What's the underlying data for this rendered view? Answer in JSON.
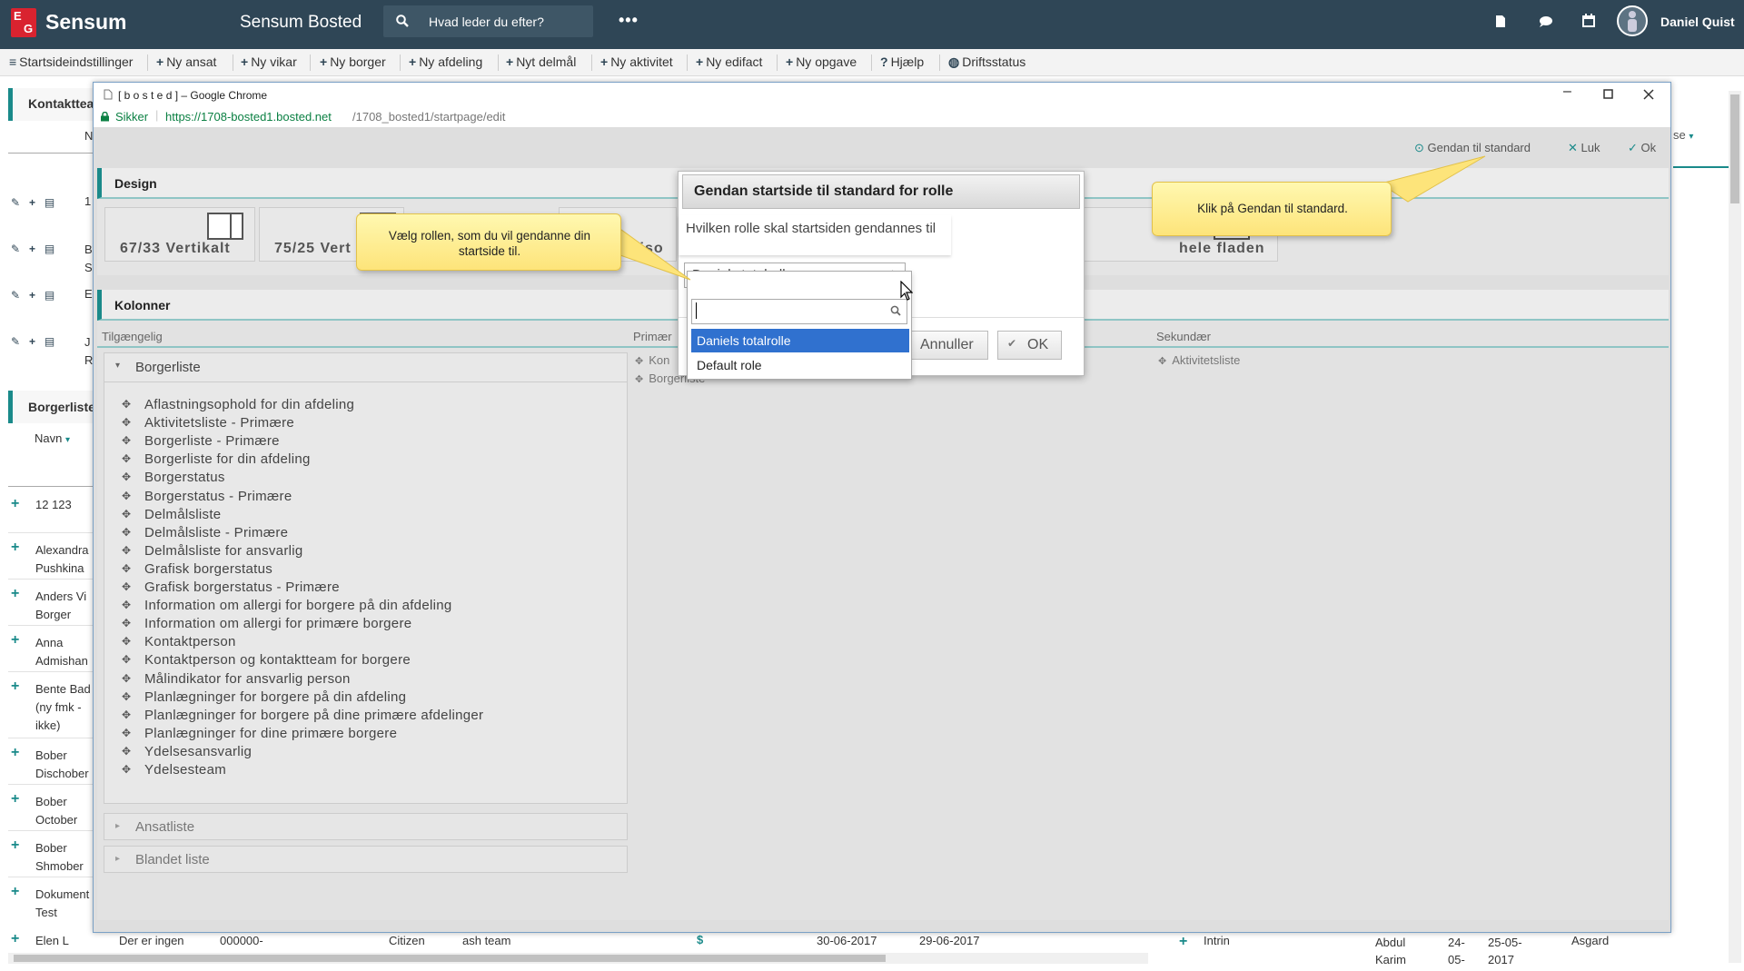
{
  "app": {
    "logo_letters": [
      "E",
      "G"
    ],
    "logo_text": "Sensum",
    "title": "Sensum Bosted",
    "search_placeholder": "Hvad leder du efter?",
    "more": "•••",
    "user": "Daniel Quist"
  },
  "toolbar": [
    {
      "label": "Startsideindstillinger",
      "icon": "≡"
    },
    {
      "label": "Ny ansat",
      "icon": "+"
    },
    {
      "label": "Ny vikar",
      "icon": "+"
    },
    {
      "label": "Ny borger",
      "icon": "+"
    },
    {
      "label": "Ny afdeling",
      "icon": "+"
    },
    {
      "label": "Nyt delmål",
      "icon": "+"
    },
    {
      "label": "Ny aktivitet",
      "icon": "+"
    },
    {
      "label": "Ny edifact",
      "icon": "+"
    },
    {
      "label": "Ny opgave",
      "icon": "+"
    },
    {
      "label": "Hjælp",
      "icon": "?"
    },
    {
      "label": "Driftsstatus",
      "icon": "◍"
    }
  ],
  "background": {
    "kontakt_title": "Kontakttea",
    "kontakt_n": "N",
    "kontakt_rows": [
      "1",
      "B\nS",
      "E",
      "J\nR"
    ],
    "borger_title": "Borgerliste",
    "borger_col": "Navn",
    "borger_first": "12 123",
    "borger_rows": [
      "Alexandra\nPushkina",
      "Anders Vi\nBorger",
      "Anna\nAdmishan",
      "Bente Bad\n(ny fmk -\nikke)",
      "Bober\nDischober",
      "Bober\nOctober",
      "Bober\nShmober",
      "Dokument\nTest",
      "Elen L"
    ],
    "bottom_row": [
      "Der er ingen",
      "000000-",
      "Citizen",
      "ash team",
      "$",
      "30-06-2017",
      "29-06-2017"
    ],
    "right_col": "se",
    "right_bottom": [
      "Intrin",
      "Abdul\nKarim",
      "24-\n05-",
      "25-05-\n2017",
      "Asgard"
    ]
  },
  "chrome": {
    "title": "[ b o s t e d ] – Google Chrome",
    "secure": "Sikker",
    "url_host": "https://1708-bosted1.bosted.net",
    "url_path": "/1708_bosted1/startpage/edit"
  },
  "edit": {
    "actions": [
      {
        "label": "Gendan til standard",
        "icon": "⊙"
      },
      {
        "label": "Luk",
        "icon": "✕"
      },
      {
        "label": "Ok",
        "icon": "✓"
      }
    ],
    "design_title": "Design",
    "design_buttons": [
      "67/33 Vertikalt",
      "75/25 Vert",
      "Horiso",
      "hele fladen"
    ],
    "kolonner_title": "Kolonner",
    "col_available": "Tilgængelig",
    "col_primary": "Primær",
    "col_secondary": "Sekundær",
    "primary_items": [
      "Kon",
      "Borgerliste"
    ],
    "secondary_items": [
      "Aktivitetsliste"
    ],
    "groups": [
      {
        "label": "Borgerliste",
        "expanded": true
      },
      {
        "label": "Ansatliste",
        "expanded": false
      },
      {
        "label": "Blandet liste",
        "expanded": false
      }
    ],
    "borgerliste_items": [
      "Aflastningsophold for din afdeling",
      "Aktivitetsliste - Primære",
      "Borgerliste - Primære",
      "Borgerliste for din afdeling",
      "Borgerstatus",
      "Borgerstatus - Primære",
      "Delmålsliste",
      "Delmålsliste - Primære",
      "Delmålsliste for ansvarlig",
      "Grafisk borgerstatus",
      "Grafisk borgerstatus - Primære",
      "Information om allergi for borgere på din afdeling",
      "Information om allergi for primære borgere",
      "Kontaktperson",
      "Kontaktperson og kontaktteam for borgere",
      "Målindikator for ansvarlig person",
      "Planlægninger for borgere på din afdeling",
      "Planlægninger for borgere på dine primære afdelinger",
      "Planlægninger for dine primære borgere",
      "Ydelsesansvarlig",
      "Ydelsesteam"
    ]
  },
  "dialog": {
    "title": "Gendan startside til standard for rolle",
    "question": "Hvilken rolle skal startsiden gendannes til",
    "selected": "Daniels totalrolle",
    "search_value": "",
    "options": [
      "Daniels totalrolle",
      "Default role"
    ],
    "cancel": "Annuller",
    "ok": "OK"
  },
  "tooltips": {
    "role": "Vælg rollen, som du vil gendanne din startside til.",
    "restore": "Klik på Gendan til standard."
  },
  "colors": {
    "topbar": "#2f4656",
    "accent": "#1a8a8a",
    "highlight": "#3071cf",
    "logo": "#d9232f",
    "tooltip": "#fde47a"
  }
}
